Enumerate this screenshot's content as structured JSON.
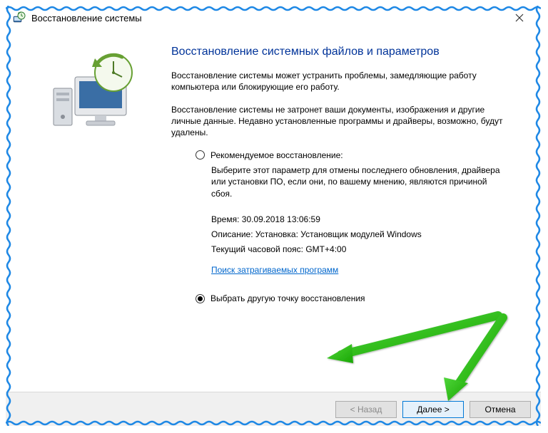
{
  "window": {
    "title": "Восстановление системы"
  },
  "heading": "Восстановление системных файлов и параметров",
  "para1": "Восстановление системы может устранить проблемы, замедляющие работу компьютера или блокирующие его работу.",
  "para2": "Восстановление системы не затронет ваши документы, изображения и другие личные данные. Недавно установленные программы и драйверы, возможно, будут удалены.",
  "option_recommended": {
    "label": "Рекомендуемое восстановление:",
    "desc": "Выберите этот параметр для отмены последнего обновления, драйвера или установки ПО, если они, по вашему мнению, являются причиной сбоя.",
    "time_line": "Время: 30.09.2018 13:06:59",
    "desc_line": "Описание: Установка: Установщик модулей Windows",
    "tz_line": "Текущий часовой пояс: GMT+4:00",
    "link": "Поиск затрагиваемых программ"
  },
  "option_choose": {
    "label": "Выбрать другую точку восстановления"
  },
  "buttons": {
    "back": "< Назад",
    "next": "Далее >",
    "cancel": "Отмена"
  }
}
